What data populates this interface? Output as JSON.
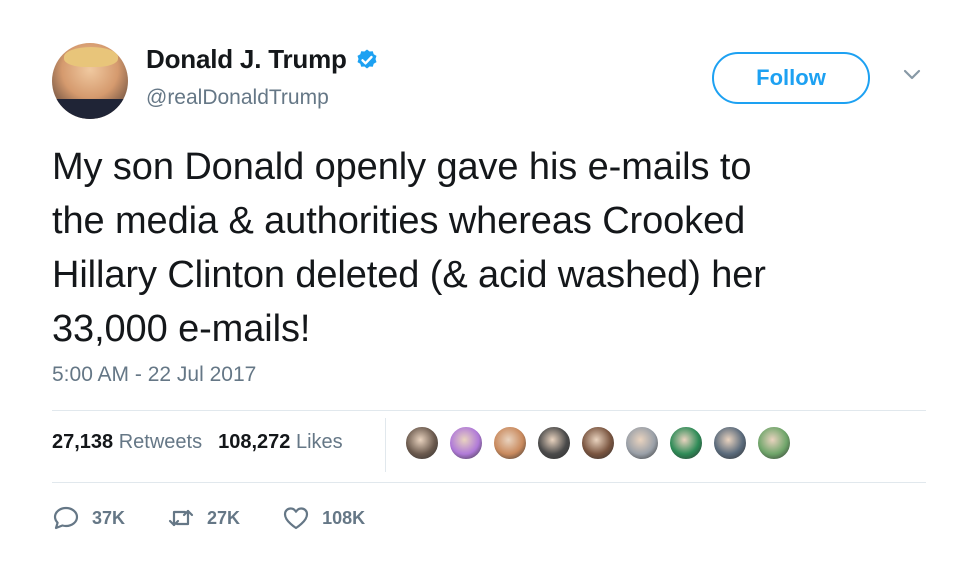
{
  "author": {
    "display_name": "Donald J. Trump",
    "handle": "@realDonaldTrump",
    "verified": true
  },
  "follow_button": {
    "label": "Follow"
  },
  "tweet": {
    "lines": [
      "My son Donald openly gave his e-mails to",
      "the media & authorities whereas Crooked",
      "Hillary Clinton deleted (& acid washed) her",
      "33,000 e-mails!"
    ],
    "timestamp": "5:00 AM - 22 Jul 2017"
  },
  "stats": {
    "retweets_count": "27,138",
    "retweets_label": "Retweets",
    "likes_count": "108,272",
    "likes_label": "Likes"
  },
  "likers": [
    {
      "icon": "liker-avatar",
      "color": "#6b5a4e"
    },
    {
      "icon": "liker-avatar",
      "color": "#b07ad8"
    },
    {
      "icon": "liker-avatar",
      "color": "#c98a5e"
    },
    {
      "icon": "liker-avatar",
      "color": "#4a4a4a"
    },
    {
      "icon": "liker-avatar",
      "color": "#7a5540"
    },
    {
      "icon": "liker-avatar",
      "color": "#9aa0a8"
    },
    {
      "icon": "liker-avatar",
      "color": "#2e8b57"
    },
    {
      "icon": "liker-avatar",
      "color": "#5b6b7c"
    },
    {
      "icon": "liker-avatar",
      "color": "#6fa56a"
    }
  ],
  "actions": {
    "reply_count": "37K",
    "retweet_count": "27K",
    "like_count": "108K"
  },
  "colors": {
    "accent": "#1da1f2",
    "text": "#14171a",
    "muted": "#657786",
    "divider": "#e1e8ed"
  }
}
